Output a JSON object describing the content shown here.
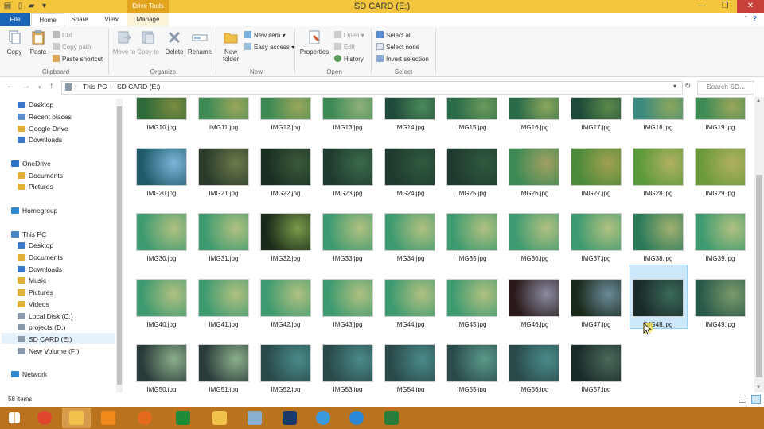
{
  "window": {
    "title": "SD CARD (E:)",
    "context_tab": "Drive Tools",
    "minimize": "—",
    "maximize": "❐",
    "close": "✕"
  },
  "tabs": [
    "File",
    "Home",
    "Share",
    "View",
    "Manage"
  ],
  "ribbon": {
    "clipboard": {
      "label": "Clipboard",
      "copy": "Copy",
      "paste": "Paste",
      "cut": "Cut",
      "copy_path": "Copy path",
      "paste_shortcut": "Paste shortcut"
    },
    "organize": {
      "label": "Organize",
      "move_to": "Move to",
      "copy_to": "Copy to",
      "delete": "Delete",
      "rename": "Rename"
    },
    "new": {
      "label": "New",
      "new_folder": "New folder",
      "new_item": "New item",
      "easy_access": "Easy access"
    },
    "open": {
      "label": "Open",
      "properties": "Properties",
      "open": "Open",
      "edit": "Edit",
      "history": "History"
    },
    "select": {
      "label": "Select",
      "select_all": "Select all",
      "select_none": "Select none",
      "invert_selection": "Invert selection"
    }
  },
  "address": {
    "crumbs": [
      "This PC",
      "SD CARD (E:)"
    ],
    "search_placeholder": "Search SD..."
  },
  "nav": {
    "items": [
      {
        "label": "Desktop",
        "color": "#3b78c9"
      },
      {
        "label": "Recent places",
        "color": "#5c8fd0"
      },
      {
        "label": "Google Drive",
        "color": "#e0b13a"
      },
      {
        "label": "Downloads",
        "color": "#3b78c9"
      },
      {
        "label": "OneDrive",
        "color": "#2c72c7"
      },
      {
        "label": "Documents",
        "color": "#e0b13a"
      },
      {
        "label": "Pictures",
        "color": "#e0b13a"
      },
      {
        "label": "Homegroup",
        "color": "#2f8ad1"
      },
      {
        "label": "This PC",
        "color": "#4b86c5"
      },
      {
        "label": "Desktop",
        "color": "#3b78c9"
      },
      {
        "label": "Documents",
        "color": "#e0b13a"
      },
      {
        "label": "Downloads",
        "color": "#3b78c9"
      },
      {
        "label": "Music",
        "color": "#e0b13a"
      },
      {
        "label": "Pictures",
        "color": "#e0b13a"
      },
      {
        "label": "Videos",
        "color": "#e0b13a"
      },
      {
        "label": "Local Disk (C:)",
        "color": "#8a9aaa"
      },
      {
        "label": "projects (D:)",
        "color": "#8a9aaa"
      },
      {
        "label": "SD CARD (E:)",
        "color": "#8a9aaa"
      },
      {
        "label": "New Volume (F:)",
        "color": "#8a9aaa"
      },
      {
        "label": "Network",
        "color": "#2f8ad1"
      }
    ]
  },
  "files": [
    {
      "name": "IMG10.jpg",
      "c1": "#2f6b3a",
      "c2": "#7a8a3e"
    },
    {
      "name": "IMG11.jpg",
      "c1": "#3d8a55",
      "c2": "#9aa65a"
    },
    {
      "name": "IMG12.jpg",
      "c1": "#3d8a55",
      "c2": "#9aa65a"
    },
    {
      "name": "IMG13.jpg",
      "c1": "#3d8a55",
      "c2": "#8fb07a"
    },
    {
      "name": "IMG14.jpg",
      "c1": "#1f4a3a",
      "c2": "#4b8a5a"
    },
    {
      "name": "IMG15.jpg",
      "c1": "#2a6b4a",
      "c2": "#6a9a5a"
    },
    {
      "name": "IMG16.jpg",
      "c1": "#2a6b4a",
      "c2": "#8aa65a"
    },
    {
      "name": "IMG17.jpg",
      "c1": "#1f4a3a",
      "c2": "#5a8a4a"
    },
    {
      "name": "IMG18.jpg",
      "c1": "#3a8a80",
      "c2": "#8aa65a"
    },
    {
      "name": "IMG19.jpg",
      "c1": "#3d8a55",
      "c2": "#9aa65a"
    },
    {
      "name": "IMG20.jpg",
      "c1": "#1e5a6a",
      "c2": "#7ab4d8"
    },
    {
      "name": "IMG21.jpg",
      "c1": "#2a3a2a",
      "c2": "#6a7a4a"
    },
    {
      "name": "IMG22.jpg",
      "c1": "#1a2e22",
      "c2": "#3a5a3a"
    },
    {
      "name": "IMG23.jpg",
      "c1": "#1f3a2e",
      "c2": "#3a6a4a"
    },
    {
      "name": "IMG24.jpg",
      "c1": "#1f3a2e",
      "c2": "#2f5a3e"
    },
    {
      "name": "IMG25.jpg",
      "c1": "#1f3a2e",
      "c2": "#2f5a3e"
    },
    {
      "name": "IMG26.jpg",
      "c1": "#3d8a55",
      "c2": "#a0a060"
    },
    {
      "name": "IMG27.jpg",
      "c1": "#4a8a3a",
      "c2": "#a0a050"
    },
    {
      "name": "IMG28.jpg",
      "c1": "#5a9a3a",
      "c2": "#b0b060"
    },
    {
      "name": "IMG29.jpg",
      "c1": "#6a9a3a",
      "c2": "#b0b060"
    },
    {
      "name": "IMG30.jpg",
      "c1": "#3d9a70",
      "c2": "#b0c080"
    },
    {
      "name": "IMG31.jpg",
      "c1": "#3d9a70",
      "c2": "#b0c080"
    },
    {
      "name": "IMG32.jpg",
      "c1": "#1a2a1a",
      "c2": "#7a9a4a"
    },
    {
      "name": "IMG33.jpg",
      "c1": "#3d9a70",
      "c2": "#b0c080"
    },
    {
      "name": "IMG34.jpg",
      "c1": "#3d9a70",
      "c2": "#b0c080"
    },
    {
      "name": "IMG35.jpg",
      "c1": "#3d9a70",
      "c2": "#b0c080"
    },
    {
      "name": "IMG36.jpg",
      "c1": "#3d9a70",
      "c2": "#b0c080"
    },
    {
      "name": "IMG37.jpg",
      "c1": "#3d9a70",
      "c2": "#b0c080"
    },
    {
      "name": "IMG38.jpg",
      "c1": "#2a7a5a",
      "c2": "#a0b070"
    },
    {
      "name": "IMG39.jpg",
      "c1": "#3d9a70",
      "c2": "#b0c080"
    },
    {
      "name": "IMG40.jpg",
      "c1": "#3d9a70",
      "c2": "#b0c080"
    },
    {
      "name": "IMG41.jpg",
      "c1": "#3d9a70",
      "c2": "#b0c080"
    },
    {
      "name": "IMG42.jpg",
      "c1": "#3d9a70",
      "c2": "#b0c080"
    },
    {
      "name": "IMG43.jpg",
      "c1": "#3d9a70",
      "c2": "#b0c080"
    },
    {
      "name": "IMG44.jpg",
      "c1": "#3d9a70",
      "c2": "#b0c080"
    },
    {
      "name": "IMG45.jpg",
      "c1": "#3d9a70",
      "c2": "#b0c080"
    },
    {
      "name": "IMG46.jpg",
      "c1": "#2a1a1a",
      "c2": "#8a8aa0"
    },
    {
      "name": "IMG47.jpg",
      "c1": "#1a2a1a",
      "c2": "#6a8a9a"
    },
    {
      "name": "IMG48.jpg",
      "c1": "#1a2a2a",
      "c2": "#3a6a5a"
    },
    {
      "name": "IMG49.jpg",
      "c1": "#2a5a4a",
      "c2": "#7a9a6a"
    },
    {
      "name": "IMG50.jpg",
      "c1": "#2a3a3a",
      "c2": "#8ab08a"
    },
    {
      "name": "IMG51.jpg",
      "c1": "#2a3a3a",
      "c2": "#8ab08a"
    },
    {
      "name": "IMG52.jpg",
      "c1": "#2a4a4a",
      "c2": "#4a8a8a"
    },
    {
      "name": "IMG53.jpg",
      "c1": "#2a4a4a",
      "c2": "#4a8a8a"
    },
    {
      "name": "IMG54.jpg",
      "c1": "#2a4a4a",
      "c2": "#4a8a8a"
    },
    {
      "name": "IMG55.jpg",
      "c1": "#2a4a4a",
      "c2": "#5a9a8a"
    },
    {
      "name": "IMG56.jpg",
      "c1": "#2a4a4a",
      "c2": "#4a8a8a"
    },
    {
      "name": "IMG57.jpg",
      "c1": "#1a2a2a",
      "c2": "#4a6a5a"
    }
  ],
  "selected_file": "IMG48.jpg",
  "status": {
    "item_count": "58 items"
  },
  "taskbar": {
    "apps": [
      {
        "name": "start-icon",
        "color": "#ffffff"
      },
      {
        "name": "chrome-icon",
        "color": "#e0452e"
      },
      {
        "name": "file-explorer-icon",
        "color": "#f1c24a"
      },
      {
        "name": "vlc-icon",
        "color": "#f08a1a"
      },
      {
        "name": "firefox-icon",
        "color": "#e56a1e"
      },
      {
        "name": "spreadsheet-icon",
        "color": "#1f8a3a"
      },
      {
        "name": "folder-icon",
        "color": "#f1c24a"
      },
      {
        "name": "photo-viewer-icon",
        "color": "#8ab0d0"
      },
      {
        "name": "photoshop-icon",
        "color": "#1a3a6a"
      },
      {
        "name": "internet-explorer-icon",
        "color": "#3a9ae0"
      },
      {
        "name": "sync-icon",
        "color": "#2a8ad8"
      },
      {
        "name": "excel-icon",
        "color": "#2a7a3a"
      }
    ]
  }
}
